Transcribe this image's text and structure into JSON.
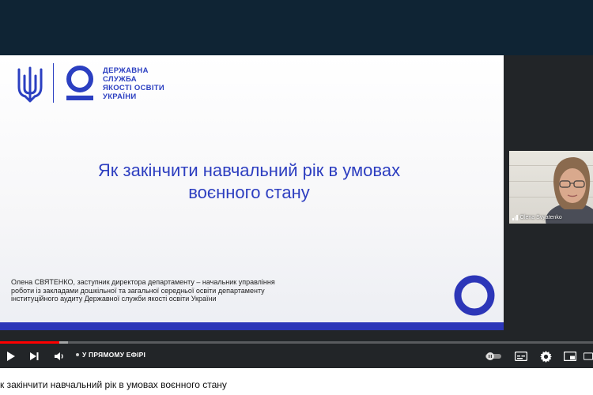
{
  "slide": {
    "org_name": "ДЕРЖАВНА\nСЛУЖБА\nЯКОСТІ ОСВІТИ\nУКРАЇНИ",
    "title": "Як закінчити навчальний рік в умовах\nвоєнного стану",
    "presenter": "Олена СВЯТЕНКО, заступник директора департаменту – начальник управління\nроботи із закладами дошкільної та загальної середньої освіти департаменту\nінституційного аудиту Державної служби якості освіти України",
    "accent_color": "#2b3fc1"
  },
  "webcam": {
    "participant_name": "Olena Svyatenko"
  },
  "player": {
    "live_label": "У ПРЯМОМУ ЕФІРІ",
    "progress_played": 0.1,
    "progress_loaded": 0.115,
    "accent_color": "#ff0000"
  },
  "video": {
    "title": "к закінчити навчальний рік в умовах воєнного стану"
  }
}
